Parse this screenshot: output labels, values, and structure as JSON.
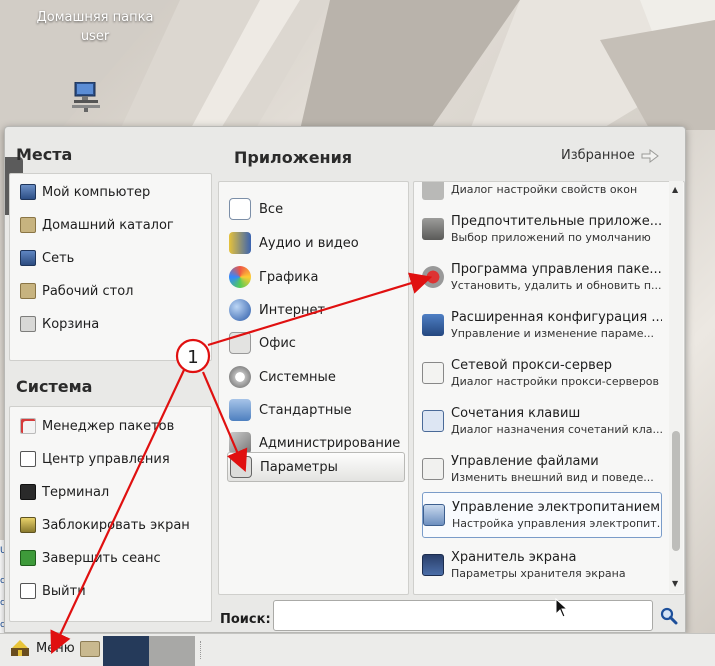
{
  "desktop": {
    "home_folder_label_line1": "Домашняя папка",
    "home_folder_label_line2": "user",
    "icons": [
      "network-computer-icon"
    ]
  },
  "left_strip": {
    "fragments": [
      "U",
      "с",
      "с",
      "с"
    ]
  },
  "places": {
    "title": "Места",
    "items": [
      {
        "label": "Мой компьютер",
        "icon": "computer-icon"
      },
      {
        "label": "Домашний каталог",
        "icon": "home-folder-icon"
      },
      {
        "label": "Сеть",
        "icon": "network-icon"
      },
      {
        "label": "Рабочий стол",
        "icon": "desktop-folder-icon"
      },
      {
        "label": "Корзина",
        "icon": "trash-icon"
      }
    ]
  },
  "system": {
    "title": "Система",
    "items": [
      {
        "label": "Менеджер пакетов",
        "icon": "package-manager-icon"
      },
      {
        "label": "Центр управления",
        "icon": "control-center-icon"
      },
      {
        "label": "Терминал",
        "icon": "terminal-icon"
      },
      {
        "label": "Заблокировать экран",
        "icon": "lock-screen-icon"
      },
      {
        "label": "Завершить сеанс",
        "icon": "logout-icon"
      },
      {
        "label": "Выйти",
        "icon": "quit-icon"
      }
    ]
  },
  "applications": {
    "title": "Приложения",
    "favorites_label": "Избранное",
    "categories": [
      {
        "label": "Все",
        "icon": "all-apps-icon"
      },
      {
        "label": "Аудио и видео",
        "icon": "multimedia-icon"
      },
      {
        "label": "Графика",
        "icon": "graphics-icon"
      },
      {
        "label": "Интернет",
        "icon": "internet-globe-icon"
      },
      {
        "label": "Офис",
        "icon": "office-icon"
      },
      {
        "label": "Системные",
        "icon": "system-gear-icon"
      },
      {
        "label": "Стандартные",
        "icon": "accessories-icon"
      },
      {
        "label": "Администрирование",
        "icon": "administration-tools-icon"
      },
      {
        "label": "Параметры",
        "icon": "preferences-icon",
        "selected": true
      }
    ],
    "apps": [
      {
        "name": "",
        "desc": "Диалог настройки свойств окон",
        "icon": "window-settings-icon"
      },
      {
        "name": "Предпочтительные приложе...",
        "desc": "Выбор приложений по умолчанию",
        "icon": "preferred-apps-icon"
      },
      {
        "name": "Программа управления паке...",
        "desc": "Установить, удалить и обновить п...",
        "icon": "package-program-icon"
      },
      {
        "name": "Расширенная конфигурация ...",
        "desc": "Управление и изменение параме...",
        "icon": "advanced-config-icon"
      },
      {
        "name": "Сетевой прокси-сервер",
        "desc": "Диалог настройки прокси-серверов",
        "icon": "proxy-icon"
      },
      {
        "name": "Сочетания клавиш",
        "desc": "Диалог назначения сочетаний кла...",
        "icon": "keyboard-shortcuts-icon"
      },
      {
        "name": "Управление файлами",
        "desc": "Изменить внешний вид и поведе...",
        "icon": "file-management-icon"
      },
      {
        "name": "Управление электропитанием",
        "desc": "Настройка управления электропит...",
        "icon": "power-management-icon",
        "selected": true
      },
      {
        "name": "Хранитель экрана",
        "desc": "Параметры хранителя экрана",
        "icon": "screensaver-icon"
      }
    ]
  },
  "search": {
    "label": "Поиск:",
    "value": "",
    "placeholder": ""
  },
  "taskbar": {
    "menu_label": "Меню"
  },
  "annotation": {
    "callout_number": "1",
    "color": "#e01010"
  }
}
